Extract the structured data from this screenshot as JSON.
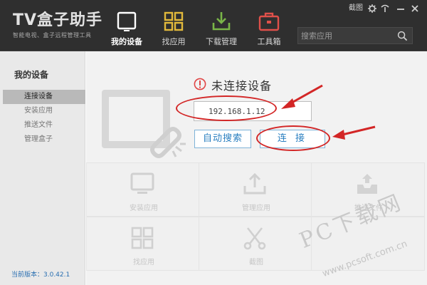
{
  "app": {
    "title": "TV盒子助手",
    "subtitle": "智能电视、盒子远程管理工具"
  },
  "window_controls": {
    "screenshot": "截图",
    "settings_icon": "gear-icon",
    "help_icon": "help-icon",
    "minimize_icon": "minimize-icon",
    "close_icon": "close-icon"
  },
  "nav": {
    "items": [
      {
        "label": "我的设备",
        "icon": "tv-icon",
        "active": true
      },
      {
        "label": "找应用",
        "icon": "grid-icon",
        "active": false
      },
      {
        "label": "下载管理",
        "icon": "download-icon",
        "active": false
      },
      {
        "label": "工具箱",
        "icon": "toolbox-icon",
        "active": false
      }
    ]
  },
  "search": {
    "placeholder": "搜索应用",
    "icon": "search-icon"
  },
  "sidebar": {
    "heading": "我的设备",
    "items": [
      {
        "label": "连接设备",
        "active": true
      },
      {
        "label": "安装应用",
        "active": false
      },
      {
        "label": "推送文件",
        "active": false
      },
      {
        "label": "管理盒子",
        "active": false
      }
    ],
    "version": "当前版本：3.0.42.1"
  },
  "main": {
    "status": "未连接设备",
    "status_icon": "warning-icon",
    "ip_value": "192.168.1.12",
    "buttons": {
      "auto_search": "自动搜索",
      "connect": "连 接"
    },
    "tiles": [
      {
        "label": "安装应用",
        "icon": "monitor-icon"
      },
      {
        "label": "管理应用",
        "icon": "upload-icon"
      },
      {
        "label": "推送文件",
        "icon": "tray-upload-icon"
      },
      {
        "label": "找应用",
        "icon": "grid-icon"
      },
      {
        "label": "截图",
        "icon": "scissors-icon"
      },
      {
        "label": "",
        "icon": ""
      }
    ]
  },
  "watermark": {
    "text": "PC下载网",
    "url": "www.pcsoft.com.cn"
  },
  "colors": {
    "topbar": "#2f2f2f",
    "sidebar": "#e9e9e9",
    "main_bg": "#f2f2f2",
    "accent_blue": "#2a7fc0",
    "annotation_red": "#d32626",
    "nav_icon_yellow": "#e2b93b",
    "nav_icon_green": "#7ab648",
    "nav_icon_red": "#e0504a"
  }
}
